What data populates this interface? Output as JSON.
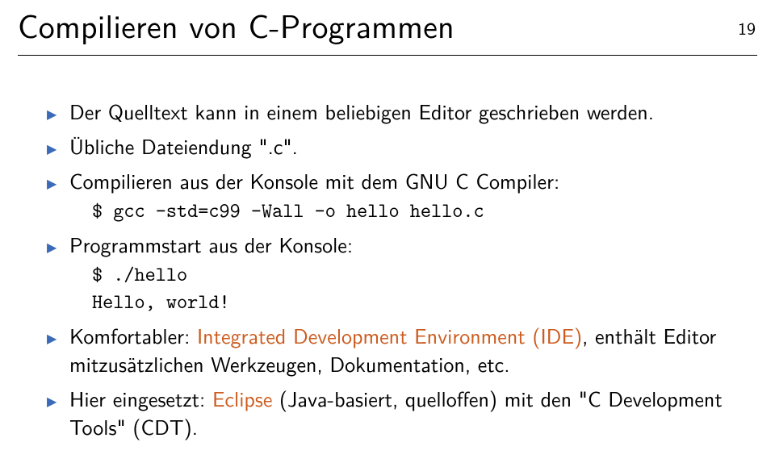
{
  "header": {
    "title": "Compilieren von C-Programmen",
    "page_number": "19"
  },
  "bullets": [
    {
      "text": "Der Quelltext kann in einem beliebigen Editor geschrieben werden."
    },
    {
      "text": "Übliche Dateiendung \".c\"."
    },
    {
      "text": "Compilieren aus der Konsole mit dem GNU C Compiler:",
      "code": "$ gcc -std=c99 -Wall -o hello hello.c"
    },
    {
      "text": "Programmstart aus der Konsole:",
      "code": "$ ./hello\nHello, world!"
    },
    {
      "prefix": "Komfortabler: ",
      "accent": "Integrated Development Environment (IDE)",
      "suffix": ", enthält Editor mitzusätzlichen Werkzeugen, Dokumentation, etc."
    },
    {
      "prefix": "Hier eingesetzt: ",
      "accent": "Eclipse",
      "suffix": " (Java-basiert, quelloffen) mit den \"C Development Tools\" (CDT)."
    }
  ]
}
